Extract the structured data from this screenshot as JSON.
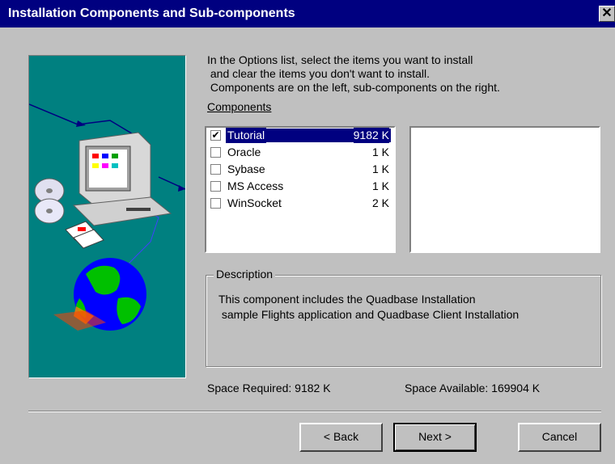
{
  "window": {
    "title": "Installation Components and Sub-components",
    "close_glyph": "✕"
  },
  "instructions": [
    "In the Options list, select the items you want to install",
    " and clear the items you don't want to install.",
    " Components are on the left, sub-components on the right."
  ],
  "components_label": "Components",
  "components": [
    {
      "name": "Tutorial",
      "size": "9182 K",
      "checked": true,
      "selected": true
    },
    {
      "name": "Oracle",
      "size": "1 K",
      "checked": false,
      "selected": false
    },
    {
      "name": "Sybase",
      "size": "1 K",
      "checked": false,
      "selected": false
    },
    {
      "name": "MS Access",
      "size": "1 K",
      "checked": false,
      "selected": false
    },
    {
      "name": "WinSocket",
      "size": "2 K",
      "checked": false,
      "selected": false
    }
  ],
  "description": {
    "legend": "Description",
    "lines": [
      "This component includes the Quadbase Installation",
      " sample Flights application and Quadbase Client Installation"
    ]
  },
  "space": {
    "required": "Space Required:  9182 K",
    "available": "Space Available:  169904 K"
  },
  "buttons": {
    "back": "< Back",
    "next": "Next >",
    "cancel": "Cancel"
  },
  "colors": {
    "title_bar": "#000080",
    "dialog_bg": "#c0c0c0",
    "illustration_bg": "#008080"
  },
  "icons": [
    "computer-icon",
    "cd-discs-icon",
    "floppy-disks-icon",
    "globe-icon"
  ]
}
